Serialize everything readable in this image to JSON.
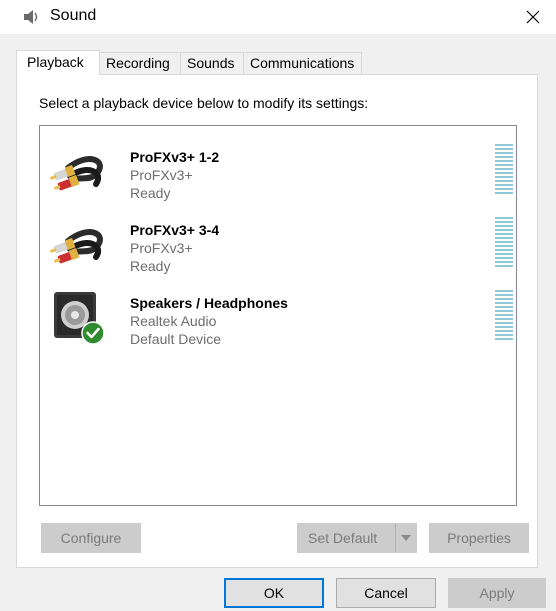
{
  "window": {
    "title": "Sound",
    "icon": "speaker-icon",
    "close_icon": "close-icon"
  },
  "tabs": [
    {
      "label": "Playback",
      "active": true
    },
    {
      "label": "Recording",
      "active": false
    },
    {
      "label": "Sounds",
      "active": false
    },
    {
      "label": "Communications",
      "active": false
    }
  ],
  "playback": {
    "instruction": "Select a playback device below to modify its settings:",
    "devices": [
      {
        "name": "ProFXv3+ 1-2",
        "driver": "ProFXv3+",
        "status": "Ready",
        "icon": "rca-cable-icon"
      },
      {
        "name": "ProFXv3+ 3-4",
        "driver": "ProFXv3+",
        "status": "Ready",
        "icon": "rca-cable-icon"
      },
      {
        "name": "Speakers / Headphones",
        "driver": "Realtek Audio",
        "status": "Default Device",
        "icon": "speaker-default-icon"
      }
    ],
    "buttons": {
      "configure": "Configure",
      "set_default": "Set Default",
      "properties": "Properties"
    }
  },
  "footer": {
    "ok": "OK",
    "cancel": "Cancel",
    "apply": "Apply"
  },
  "colors": {
    "accent": "#0078d7",
    "level_meter": "#8fc9d5",
    "default_check": "#2e8b2e"
  }
}
